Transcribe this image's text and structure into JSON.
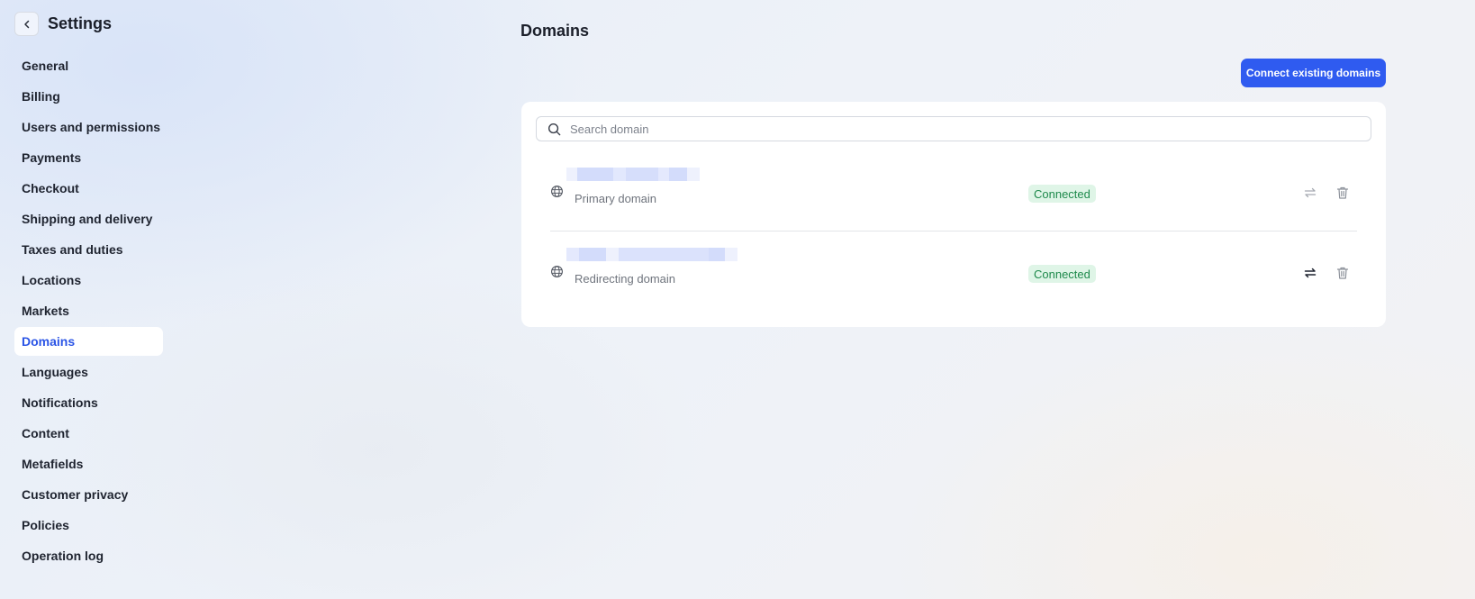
{
  "sidebar": {
    "title": "Settings",
    "items": [
      {
        "label": "General",
        "active": false
      },
      {
        "label": "Billing",
        "active": false
      },
      {
        "label": "Users and permissions",
        "active": false
      },
      {
        "label": "Payments",
        "active": false
      },
      {
        "label": "Checkout",
        "active": false
      },
      {
        "label": "Shipping and delivery",
        "active": false
      },
      {
        "label": "Taxes and duties",
        "active": false
      },
      {
        "label": "Locations",
        "active": false
      },
      {
        "label": "Markets",
        "active": false
      },
      {
        "label": "Domains",
        "active": true
      },
      {
        "label": "Languages",
        "active": false
      },
      {
        "label": "Notifications",
        "active": false
      },
      {
        "label": "Content",
        "active": false
      },
      {
        "label": "Metafields",
        "active": false
      },
      {
        "label": "Customer privacy",
        "active": false
      },
      {
        "label": "Policies",
        "active": false
      },
      {
        "label": "Operation log",
        "active": false
      }
    ]
  },
  "main": {
    "title": "Domains",
    "connect_button": "Connect existing domains",
    "search": {
      "placeholder": "Search domain",
      "value": ""
    },
    "domains": [
      {
        "type": "Primary domain",
        "status": "Connected",
        "redirect_enabled": false
      },
      {
        "type": "Redirecting domain",
        "status": "Connected",
        "redirect_enabled": true
      }
    ]
  },
  "colors": {
    "accent": "#2f5bf0",
    "active_nav_text": "#2b55e6",
    "status_bg": "#dff5e7",
    "status_text": "#1f8a4c",
    "blur_a": "#d3dcfb",
    "blur_b": "#e6ebfd"
  },
  "icons": {
    "back": "chevron-left-icon",
    "search": "search-icon",
    "globe": "globe-icon",
    "redirect": "swap-arrows-icon",
    "delete": "trash-icon"
  }
}
